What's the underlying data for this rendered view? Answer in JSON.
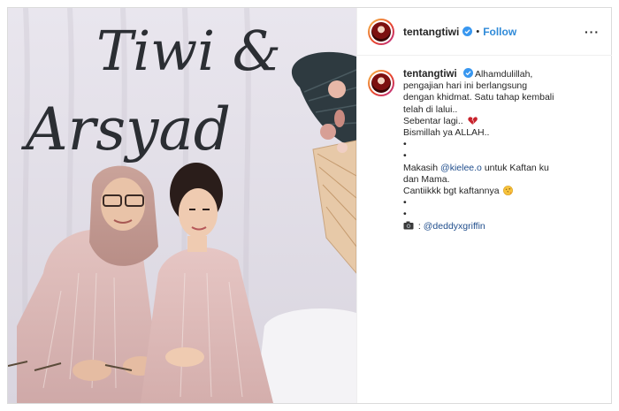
{
  "post": {
    "username": "tentangtiwi",
    "follow_label": "Follow",
    "dot": "•",
    "more": "···",
    "photo": {
      "signage_line1": "Tiwi &",
      "signage_line2": "Arsyad"
    }
  },
  "caption": {
    "username": "tentangtiwi",
    "lines": [
      "Alhamdulillah,",
      "pengajian hari ini berlangsung",
      "dengan khidmat. Satu tahap kembali",
      "telah di lalui..",
      "Sebentar lagi..",
      "Bismillah ya ALLAH..",
      "•",
      "•",
      "Makasih",
      "@kielee.o",
      "untuk Kaftan ku",
      "dan Mama.",
      "Cantiikkk bgt kaftannya",
      "•",
      "•",
      ":",
      "@deddyxgriffin"
    ],
    "icons": {
      "heart": "broken-heart-emoji",
      "smile": "face-blowing-kiss-emoji",
      "camera": "camera-icon"
    }
  },
  "colors": {
    "link": "#1f4d8c",
    "follow": "#2f8ad8",
    "verified": "#3897f0"
  }
}
